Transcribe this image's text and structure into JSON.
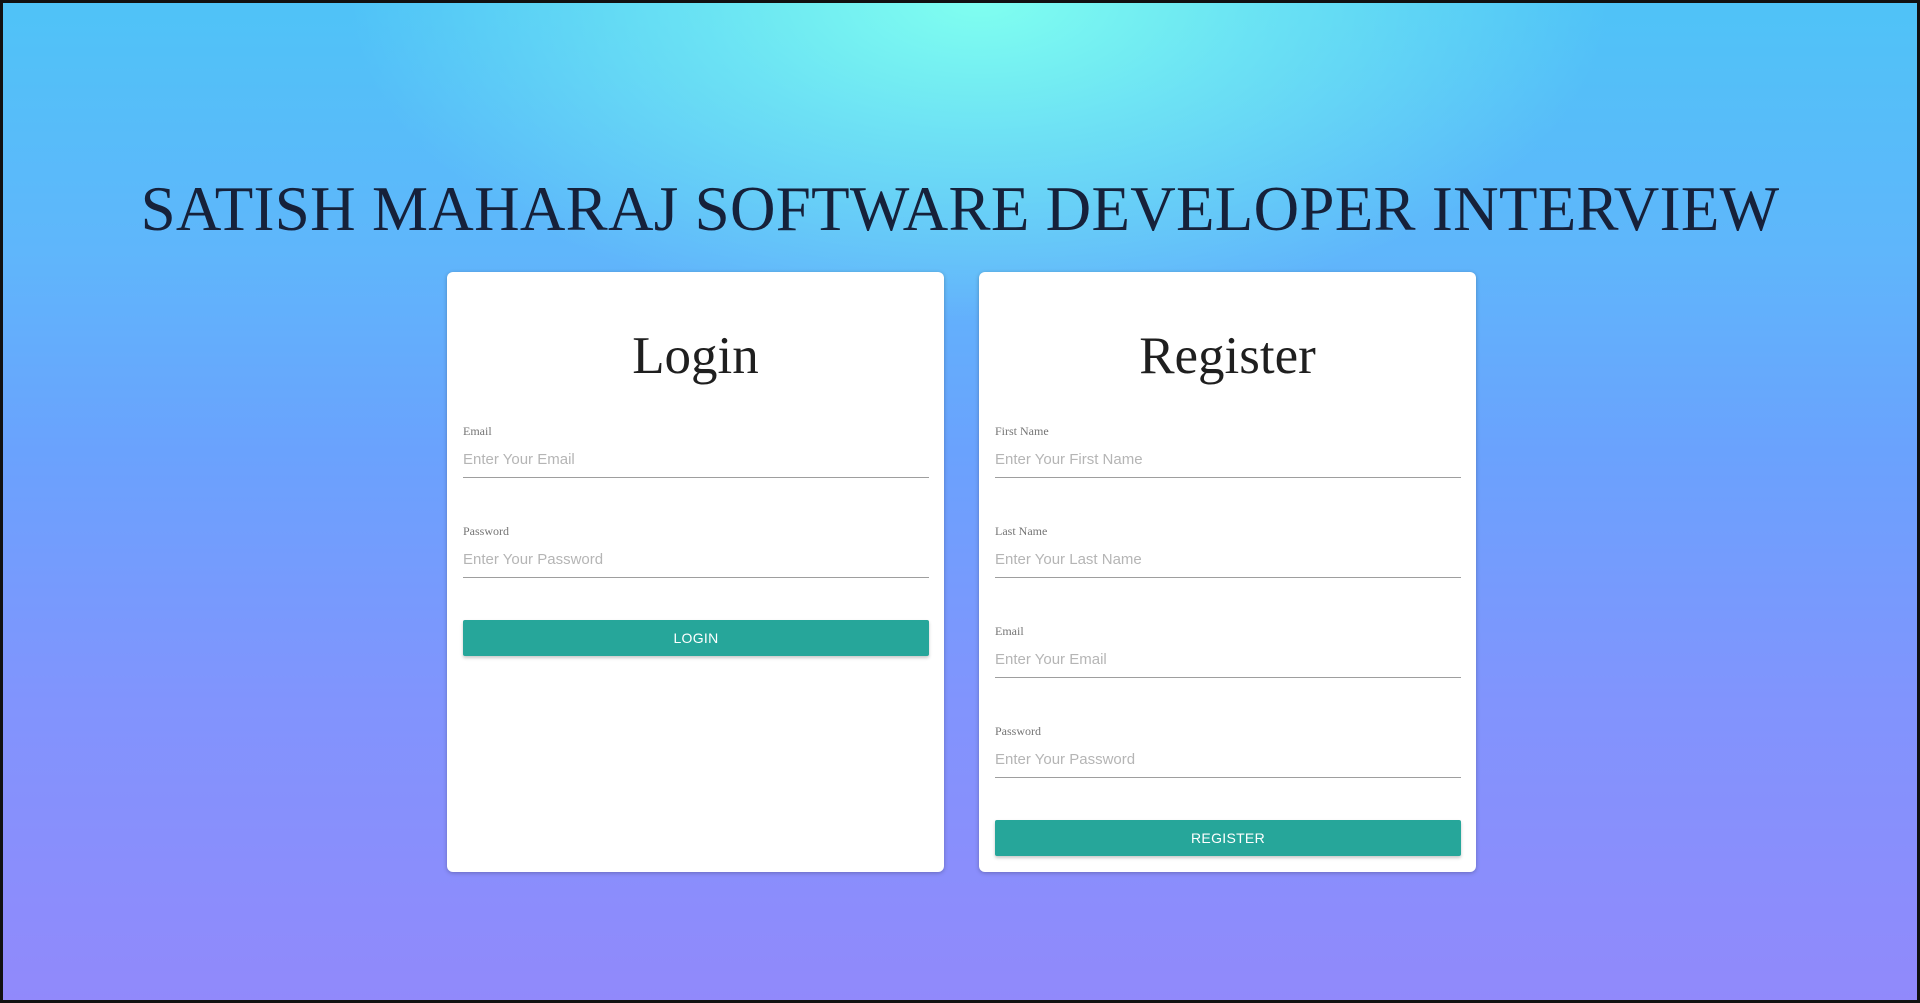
{
  "page": {
    "title": "SATISH MAHARAJ SOFTWARE DEVELOPER INTERVIEW"
  },
  "login": {
    "title": "Login",
    "email": {
      "label": "Email",
      "placeholder": "Enter Your Email",
      "value": ""
    },
    "password": {
      "label": "Password",
      "placeholder": "Enter Your Password",
      "value": ""
    },
    "button_label": "LOGIN"
  },
  "register": {
    "title": "Register",
    "first_name": {
      "label": "First Name",
      "placeholder": "Enter Your First Name",
      "value": ""
    },
    "last_name": {
      "label": "Last Name",
      "placeholder": "Enter Your Last Name",
      "value": ""
    },
    "email": {
      "label": "Email",
      "placeholder": "Enter Your Email",
      "value": ""
    },
    "password": {
      "label": "Password",
      "placeholder": "Enter Your Password",
      "value": ""
    },
    "button_label": "REGISTER"
  },
  "colors": {
    "button": "#26a69a",
    "title_text": "#16213a",
    "background_top": "#80fff0",
    "background_bottom": "#9189fb"
  }
}
